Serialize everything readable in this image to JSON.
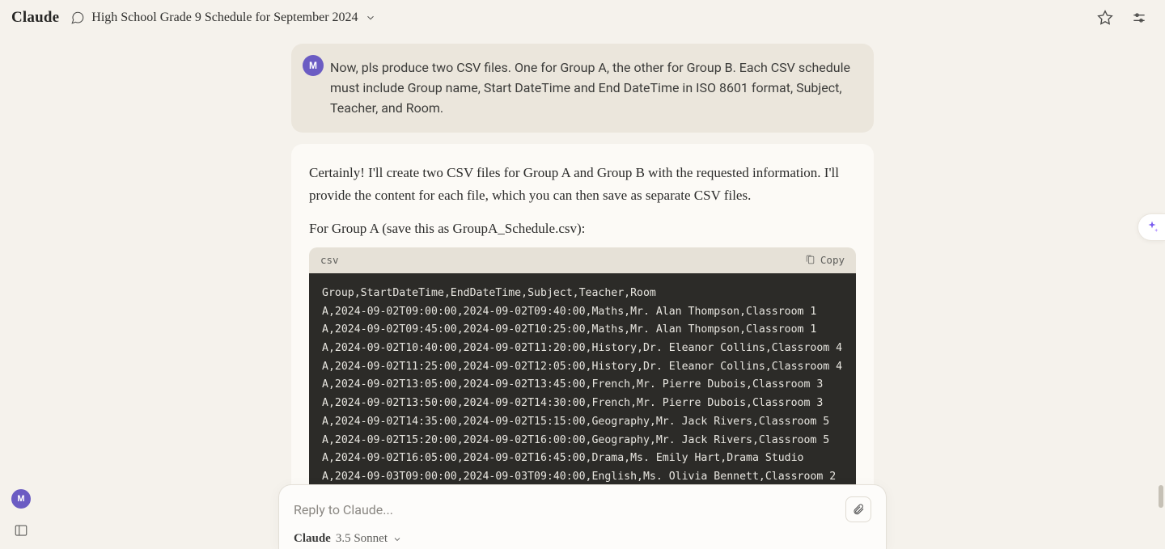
{
  "header": {
    "brand": "Claude",
    "title": "High School Grade 9 Schedule for September 2024"
  },
  "user_avatar_letter": "M",
  "user_message": "Now, pls produce two CSV files. One for Group A, the other for Group B. Each CSV schedule must include Group name, Start DateTime and End DateTime in ISO 8601 format, Subject, Teacher, and Room.",
  "assistant": {
    "para1": "Certainly! I'll create two CSV files for Group A and Group B with the requested information. I'll provide the content for each file, which you can then save as separate CSV files.",
    "para2": "For Group A (save this as GroupA_Schedule.csv):",
    "code_lang": "csv",
    "copy_label": "Copy",
    "code_lines": [
      "Group,StartDateTime,EndDateTime,Subject,Teacher,Room",
      "A,2024-09-02T09:00:00,2024-09-02T09:40:00,Maths,Mr. Alan Thompson,Classroom 1",
      "A,2024-09-02T09:45:00,2024-09-02T10:25:00,Maths,Mr. Alan Thompson,Classroom 1",
      "A,2024-09-02T10:40:00,2024-09-02T11:20:00,History,Dr. Eleanor Collins,Classroom 4",
      "A,2024-09-02T11:25:00,2024-09-02T12:05:00,History,Dr. Eleanor Collins,Classroom 4",
      "A,2024-09-02T13:05:00,2024-09-02T13:45:00,French,Mr. Pierre Dubois,Classroom 3",
      "A,2024-09-02T13:50:00,2024-09-02T14:30:00,French,Mr. Pierre Dubois,Classroom 3",
      "A,2024-09-02T14:35:00,2024-09-02T15:15:00,Geography,Mr. Jack Rivers,Classroom 5",
      "A,2024-09-02T15:20:00,2024-09-02T16:00:00,Geography,Mr. Jack Rivers,Classroom 5",
      "A,2024-09-02T16:05:00,2024-09-02T16:45:00,Drama,Ms. Emily Hart,Drama Studio",
      "A,2024-09-03T09:00:00,2024-09-03T09:40:00,English,Ms. Olivia Bennett,Classroom 2"
    ]
  },
  "composer": {
    "placeholder": "Reply to Claude...",
    "model_bold": "Claude",
    "model_light": "3.5 Sonnet"
  }
}
